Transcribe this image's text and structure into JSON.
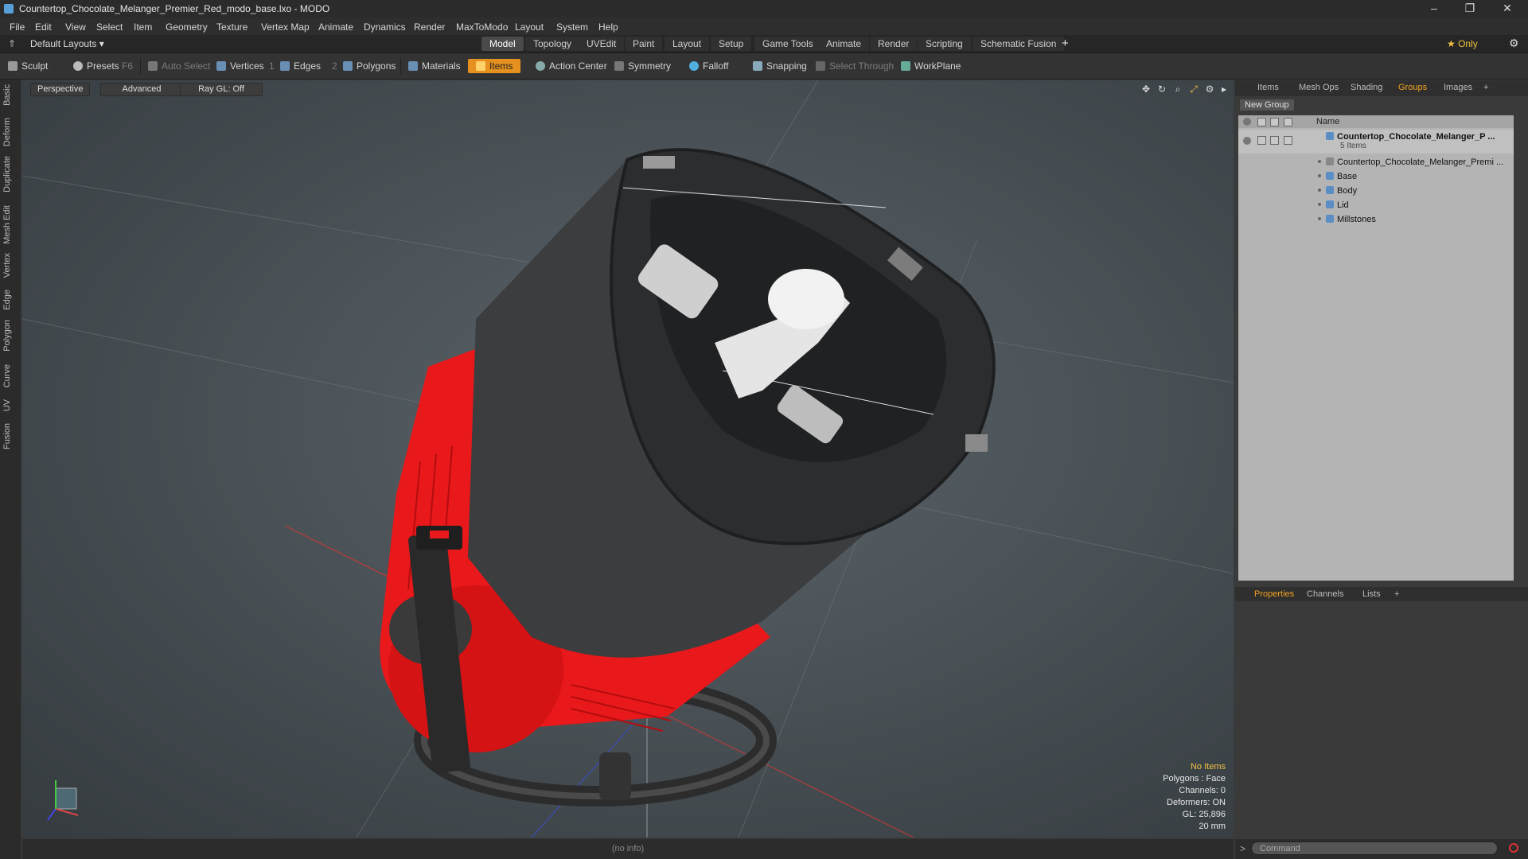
{
  "window": {
    "title": "Countertop_Chocolate_Melanger_Premier_Red_modo_base.lxo - MODO",
    "minimize": "–",
    "restore": "❐",
    "close": "✕"
  },
  "menu": [
    "File",
    "Edit",
    "View",
    "Select",
    "Item",
    "Geometry",
    "Texture",
    "Vertex Map",
    "Animate",
    "Dynamics",
    "Render",
    "MaxToModo",
    "Layout",
    "System",
    "Help"
  ],
  "layout": {
    "preset": "Default Layouts ▾",
    "tabs": [
      "Model",
      "Topology",
      "UVEdit",
      "Paint",
      "Layout",
      "Setup",
      "Game Tools",
      "Animate",
      "Render",
      "Scripting",
      "Schematic Fusion"
    ],
    "active_tab": "Model",
    "add": "+",
    "only_label": "★ Only",
    "gear": "⚙"
  },
  "toolbar": {
    "sculpt": "Sculpt",
    "presets": "Presets",
    "presets_key": "F6",
    "auto_select": "Auto Select",
    "vertices": "Vertices",
    "vertices_count": "1",
    "edges": "Edges",
    "edges_count": "2",
    "polygons": "Polygons",
    "materials": "Materials",
    "items": "Items",
    "action_center": "Action Center",
    "symmetry": "Symmetry",
    "falloff": "Falloff",
    "snapping": "Snapping",
    "select_through": "Select Through",
    "workplane": "WorkPlane"
  },
  "left_tabs": [
    "Basic",
    "Deform",
    "Duplicate",
    "Mesh Edit",
    "Vertex",
    "Edge",
    "Polygon",
    "Curve",
    "UV",
    "Fusion"
  ],
  "viewport": {
    "view": "Perspective",
    "shading": "Advanced",
    "raygl": "Ray GL: Off",
    "hud": {
      "selection": "No Items",
      "polygons": "Polygons : Face",
      "channels": "Channels: 0",
      "deformers": "Deformers: ON",
      "gl": "GL: 25,896",
      "scale": "20 mm"
    }
  },
  "right_panel": {
    "tabs": [
      "Items",
      "Mesh Ops",
      "Shading",
      "Groups",
      "Images"
    ],
    "active_tab": "Groups",
    "new_group": "New Group",
    "column_name": "Name",
    "root": {
      "name": "Countertop_Chocolate_Melanger_P ...",
      "count": "5 Items"
    },
    "children": [
      "Countertop_Chocolate_Melanger_Premi ...",
      "Base",
      "Body",
      "Lid",
      "Millstones"
    ],
    "bottom_tabs": [
      "Properties",
      "Channels",
      "Lists"
    ],
    "bottom_active": "Properties"
  },
  "status": {
    "info": "(no info)",
    "command_placeholder": "Command",
    "prompt": ">"
  },
  "colors": {
    "accent": "#f0a020",
    "items_active": "#e6911f",
    "body_red": "#e8181b"
  }
}
